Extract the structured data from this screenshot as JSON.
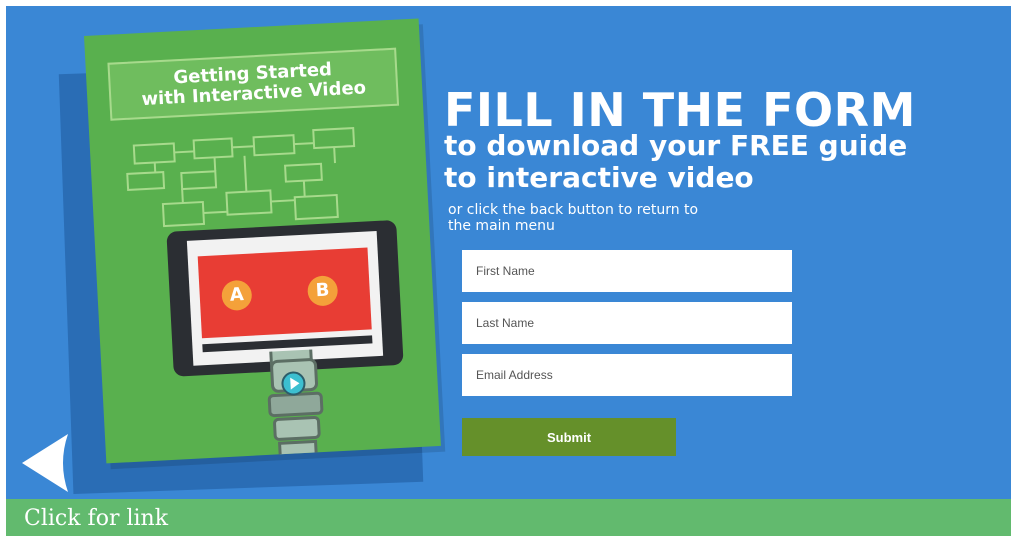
{
  "book": {
    "title_line1": "Getting Started",
    "title_line2": "with Interactive Video",
    "choice_a": "A",
    "choice_b": "B"
  },
  "hero": {
    "headline": "FILL IN THE FORM",
    "sub_line1_pre": "to download your ",
    "sub_line1_em": "FREE",
    "sub_line1_post": " guide",
    "sub_line2": "to interactive video",
    "note_line1": "or click the back button to return to",
    "note_line2": "the main menu"
  },
  "form": {
    "first_name_placeholder": "First Name",
    "last_name_placeholder": "Last Name",
    "email_placeholder": "Email Address",
    "submit_label": "Submit"
  },
  "footer": {
    "link_text": "Click for link"
  },
  "colors": {
    "background": "#3a87d5",
    "book": "#59b04e",
    "submit": "#65902a",
    "footer": "#62ba6e"
  },
  "icons": {
    "back": "back-arrow-icon",
    "play": "play-icon"
  }
}
